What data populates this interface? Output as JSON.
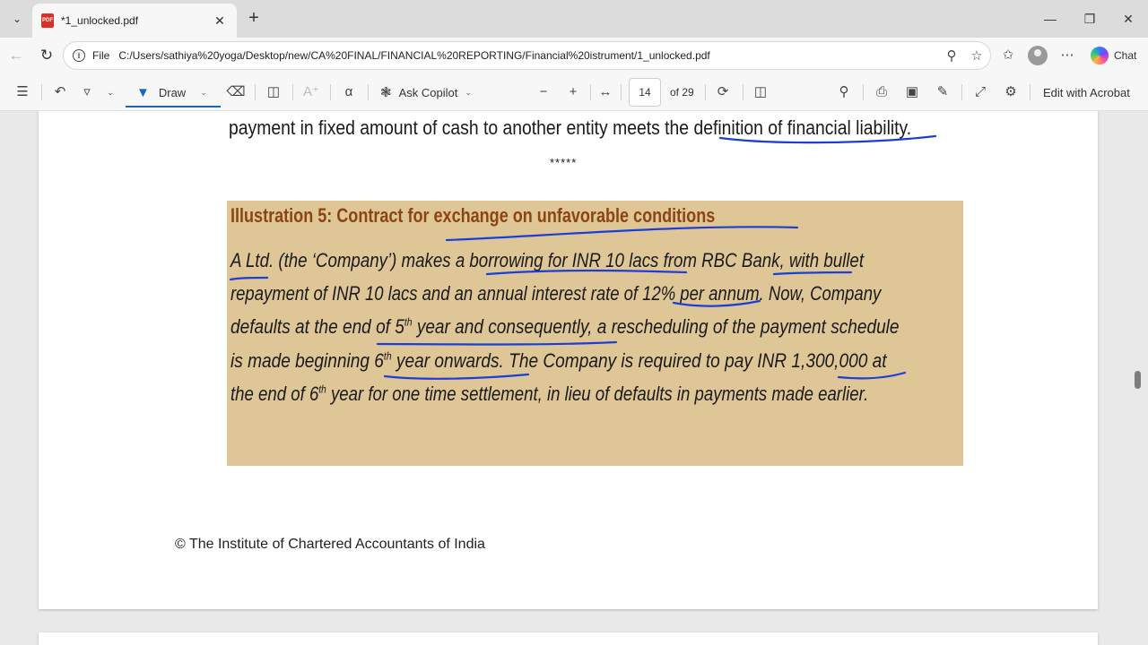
{
  "browser": {
    "tab_title": "*1_unlocked.pdf",
    "favicon_text": "PDF",
    "address_prefix": "File",
    "url": "C:/Users/sathiya%20yoga/Desktop/new/CA%20FINAL/FINANCIAL%20REPORTING/Financial%20istrument/1_unlocked.pdf",
    "chat_label": "Chat"
  },
  "pdf_toolbar": {
    "draw_label": "Draw",
    "ask_copilot_label": "Ask Copilot",
    "page_number": "14",
    "page_total": "of 29",
    "edit_label": "Edit with Acrobat"
  },
  "document": {
    "line_top": "payment in fixed amount of cash to another entity meets the definition of financial liability.",
    "separator": "*****",
    "illustration": {
      "title": "Illustration 5: Contract for exchange on unfavorable conditions",
      "line1": "A Ltd. (the ‘Company’) makes a borrowing for INR 10 lacs from RBC Bank, with bullet",
      "line2": "repayment of INR 10 lacs and an annual interest rate of 12% per annum.  Now, Company",
      "line3_a": "defaults at the end of 5",
      "line3_sup": "th",
      "line3_b": " year and consequently, a rescheduling of the payment schedule",
      "line4_a": "is made beginning 6",
      "line4_sup": "th",
      "line4_b": " year onwards.  The Company is required to pay INR 1,300,000 at",
      "line5_a": "the end of 6",
      "line5_sup": "th",
      "line5_b": " year for one time settlement, in lieu of defaults in payments made earlier."
    },
    "footer": "© The Institute of Chartered Accountants of India"
  }
}
